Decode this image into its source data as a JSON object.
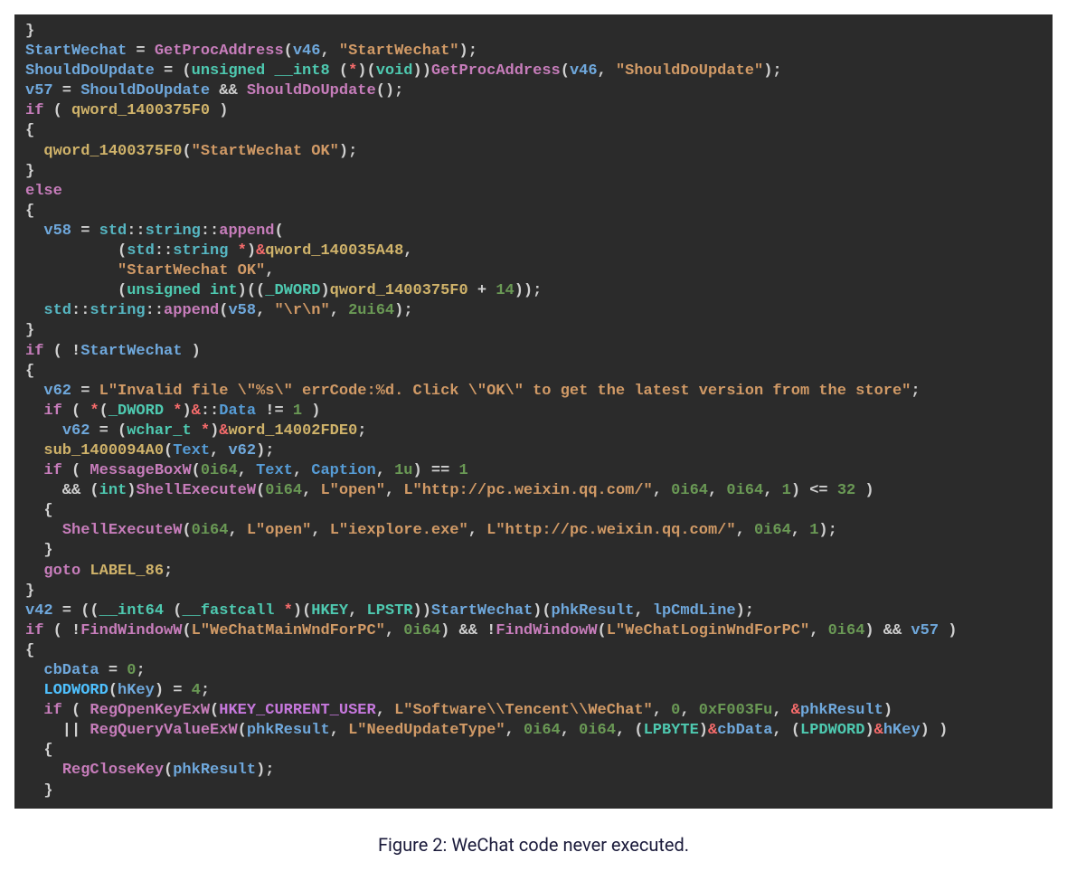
{
  "caption": "Figure 2: WeChat code never executed.",
  "code": {
    "lines": [
      [
        {
          "t": "t-sym",
          "v": "}"
        }
      ],
      [
        {
          "t": "t-var",
          "v": "StartWechat"
        },
        {
          "t": "t-sym",
          "v": " = "
        },
        {
          "t": "t-fn",
          "v": "GetProcAddress"
        },
        {
          "t": "t-sym",
          "v": "("
        },
        {
          "t": "t-var",
          "v": "v46"
        },
        {
          "t": "t-sym",
          "v": ", "
        },
        {
          "t": "t-str",
          "v": "\"StartWechat\""
        },
        {
          "t": "t-sym",
          "v": ");"
        }
      ],
      [
        {
          "t": "t-var",
          "v": "ShouldDoUpdate"
        },
        {
          "t": "t-sym",
          "v": " = ("
        },
        {
          "t": "t-type",
          "v": "unsigned __int8"
        },
        {
          "t": "t-sym",
          "v": " ("
        },
        {
          "t": "t-amp",
          "v": "*"
        },
        {
          "t": "t-sym",
          "v": ")("
        },
        {
          "t": "t-type",
          "v": "void"
        },
        {
          "t": "t-sym",
          "v": "))"
        },
        {
          "t": "t-fn",
          "v": "GetProcAddress"
        },
        {
          "t": "t-sym",
          "v": "("
        },
        {
          "t": "t-var",
          "v": "v46"
        },
        {
          "t": "t-sym",
          "v": ", "
        },
        {
          "t": "t-str",
          "v": "\"ShouldDoUpdate\""
        },
        {
          "t": "t-sym",
          "v": ");"
        }
      ],
      [
        {
          "t": "t-var",
          "v": "v57"
        },
        {
          "t": "t-sym",
          "v": " = "
        },
        {
          "t": "t-var",
          "v": "ShouldDoUpdate"
        },
        {
          "t": "t-sym",
          "v": " && "
        },
        {
          "t": "t-fn",
          "v": "ShouldDoUpdate"
        },
        {
          "t": "t-sym",
          "v": "();"
        }
      ],
      [
        {
          "t": "t-kw",
          "v": "if"
        },
        {
          "t": "t-sym",
          "v": " ( "
        },
        {
          "t": "t-glob",
          "v": "qword_1400375F0"
        },
        {
          "t": "t-sym",
          "v": " )"
        }
      ],
      [
        {
          "t": "t-sym",
          "v": "{"
        }
      ],
      [
        {
          "t": "t-sym",
          "v": "  "
        },
        {
          "t": "t-glob",
          "v": "qword_1400375F0"
        },
        {
          "t": "t-sym",
          "v": "("
        },
        {
          "t": "t-str",
          "v": "\"StartWechat OK\""
        },
        {
          "t": "t-sym",
          "v": ");"
        }
      ],
      [
        {
          "t": "t-sym",
          "v": "}"
        }
      ],
      [
        {
          "t": "t-kw",
          "v": "else"
        }
      ],
      [
        {
          "t": "t-sym",
          "v": "{"
        }
      ],
      [
        {
          "t": "t-sym",
          "v": "  "
        },
        {
          "t": "t-var",
          "v": "v58"
        },
        {
          "t": "t-sym",
          "v": " = "
        },
        {
          "t": "t-ns",
          "v": "std"
        },
        {
          "t": "t-sym",
          "v": "::"
        },
        {
          "t": "t-ns",
          "v": "string"
        },
        {
          "t": "t-sym",
          "v": "::"
        },
        {
          "t": "t-fn",
          "v": "append"
        },
        {
          "t": "t-sym",
          "v": "("
        }
      ],
      [
        {
          "t": "t-sym",
          "v": "          ("
        },
        {
          "t": "t-ns",
          "v": "std"
        },
        {
          "t": "t-sym",
          "v": "::"
        },
        {
          "t": "t-ns",
          "v": "string"
        },
        {
          "t": "t-sym",
          "v": " "
        },
        {
          "t": "t-amp",
          "v": "*"
        },
        {
          "t": "t-sym",
          "v": ")"
        },
        {
          "t": "t-amp",
          "v": "&"
        },
        {
          "t": "t-glob",
          "v": "qword_140035A48"
        },
        {
          "t": "t-sym",
          "v": ","
        }
      ],
      [
        {
          "t": "t-sym",
          "v": "          "
        },
        {
          "t": "t-str",
          "v": "\"StartWechat OK\""
        },
        {
          "t": "t-sym",
          "v": ","
        }
      ],
      [
        {
          "t": "t-sym",
          "v": "          ("
        },
        {
          "t": "t-type",
          "v": "unsigned int"
        },
        {
          "t": "t-sym",
          "v": ")(("
        },
        {
          "t": "t-type",
          "v": "_DWORD"
        },
        {
          "t": "t-sym",
          "v": ")"
        },
        {
          "t": "t-glob",
          "v": "qword_1400375F0"
        },
        {
          "t": "t-sym",
          "v": " + "
        },
        {
          "t": "t-num",
          "v": "14"
        },
        {
          "t": "t-sym",
          "v": "));"
        }
      ],
      [
        {
          "t": "t-sym",
          "v": "  "
        },
        {
          "t": "t-ns",
          "v": "std"
        },
        {
          "t": "t-sym",
          "v": "::"
        },
        {
          "t": "t-ns",
          "v": "string"
        },
        {
          "t": "t-sym",
          "v": "::"
        },
        {
          "t": "t-fn",
          "v": "append"
        },
        {
          "t": "t-sym",
          "v": "("
        },
        {
          "t": "t-var",
          "v": "v58"
        },
        {
          "t": "t-sym",
          "v": ", "
        },
        {
          "t": "t-str",
          "v": "\"\\r\\n\""
        },
        {
          "t": "t-sym",
          "v": ", "
        },
        {
          "t": "t-num",
          "v": "2ui64"
        },
        {
          "t": "t-sym",
          "v": ");"
        }
      ],
      [
        {
          "t": "t-sym",
          "v": "}"
        }
      ],
      [
        {
          "t": "t-kw",
          "v": "if"
        },
        {
          "t": "t-sym",
          "v": " ( !"
        },
        {
          "t": "t-var",
          "v": "StartWechat"
        },
        {
          "t": "t-sym",
          "v": " )"
        }
      ],
      [
        {
          "t": "t-sym",
          "v": "{"
        }
      ],
      [
        {
          "t": "t-sym",
          "v": "  "
        },
        {
          "t": "t-var",
          "v": "v62"
        },
        {
          "t": "t-sym",
          "v": " = "
        },
        {
          "t": "t-str",
          "v": "L\"Invalid file \\\"%s\\\" errCode:%d. Click \\\"OK\\\" to get the latest version from the store\""
        },
        {
          "t": "t-sym",
          "v": ";"
        }
      ],
      [
        {
          "t": "t-sym",
          "v": "  "
        },
        {
          "t": "t-kw",
          "v": "if"
        },
        {
          "t": "t-sym",
          "v": " ( "
        },
        {
          "t": "t-amp",
          "v": "*"
        },
        {
          "t": "t-sym",
          "v": "("
        },
        {
          "t": "t-type",
          "v": "_DWORD "
        },
        {
          "t": "t-amp",
          "v": "*"
        },
        {
          "t": "t-sym",
          "v": ")"
        },
        {
          "t": "t-amp",
          "v": "&"
        },
        {
          "t": "t-sym",
          "v": "::"
        },
        {
          "t": "t-text",
          "v": "Data"
        },
        {
          "t": "t-sym",
          "v": " != "
        },
        {
          "t": "t-num",
          "v": "1"
        },
        {
          "t": "t-sym",
          "v": " )"
        }
      ],
      [
        {
          "t": "t-sym",
          "v": "    "
        },
        {
          "t": "t-var",
          "v": "v62"
        },
        {
          "t": "t-sym",
          "v": " = ("
        },
        {
          "t": "t-type",
          "v": "wchar_t "
        },
        {
          "t": "t-amp",
          "v": "*"
        },
        {
          "t": "t-sym",
          "v": ")"
        },
        {
          "t": "t-amp",
          "v": "&"
        },
        {
          "t": "t-glob",
          "v": "word_14002FDE0"
        },
        {
          "t": "t-sym",
          "v": ";"
        }
      ],
      [
        {
          "t": "t-sym",
          "v": "  "
        },
        {
          "t": "t-glob",
          "v": "sub_1400094A0"
        },
        {
          "t": "t-sym",
          "v": "("
        },
        {
          "t": "t-text",
          "v": "Text"
        },
        {
          "t": "t-sym",
          "v": ", "
        },
        {
          "t": "t-var",
          "v": "v62"
        },
        {
          "t": "t-sym",
          "v": ");"
        }
      ],
      [
        {
          "t": "t-sym",
          "v": "  "
        },
        {
          "t": "t-kw",
          "v": "if"
        },
        {
          "t": "t-sym",
          "v": " ( "
        },
        {
          "t": "t-fn",
          "v": "MessageBoxW"
        },
        {
          "t": "t-sym",
          "v": "("
        },
        {
          "t": "t-num",
          "v": "0i64"
        },
        {
          "t": "t-sym",
          "v": ", "
        },
        {
          "t": "t-text",
          "v": "Text"
        },
        {
          "t": "t-sym",
          "v": ", "
        },
        {
          "t": "t-text",
          "v": "Caption"
        },
        {
          "t": "t-sym",
          "v": ", "
        },
        {
          "t": "t-num",
          "v": "1u"
        },
        {
          "t": "t-sym",
          "v": ") == "
        },
        {
          "t": "t-num",
          "v": "1"
        }
      ],
      [
        {
          "t": "t-sym",
          "v": "    && ("
        },
        {
          "t": "t-type",
          "v": "int"
        },
        {
          "t": "t-sym",
          "v": ")"
        },
        {
          "t": "t-fn",
          "v": "ShellExecuteW"
        },
        {
          "t": "t-sym",
          "v": "("
        },
        {
          "t": "t-num",
          "v": "0i64"
        },
        {
          "t": "t-sym",
          "v": ", "
        },
        {
          "t": "t-str",
          "v": "L\"open\""
        },
        {
          "t": "t-sym",
          "v": ", "
        },
        {
          "t": "t-str",
          "v": "L\"http://pc.weixin.qq.com/\""
        },
        {
          "t": "t-sym",
          "v": ", "
        },
        {
          "t": "t-num",
          "v": "0i64"
        },
        {
          "t": "t-sym",
          "v": ", "
        },
        {
          "t": "t-num",
          "v": "0i64"
        },
        {
          "t": "t-sym",
          "v": ", "
        },
        {
          "t": "t-num",
          "v": "1"
        },
        {
          "t": "t-sym",
          "v": ") <= "
        },
        {
          "t": "t-num",
          "v": "32"
        },
        {
          "t": "t-sym",
          "v": " )"
        }
      ],
      [
        {
          "t": "t-sym",
          "v": "  {"
        }
      ],
      [
        {
          "t": "t-sym",
          "v": "    "
        },
        {
          "t": "t-fn",
          "v": "ShellExecuteW"
        },
        {
          "t": "t-sym",
          "v": "("
        },
        {
          "t": "t-num",
          "v": "0i64"
        },
        {
          "t": "t-sym",
          "v": ", "
        },
        {
          "t": "t-str",
          "v": "L\"open\""
        },
        {
          "t": "t-sym",
          "v": ", "
        },
        {
          "t": "t-str",
          "v": "L\"iexplore.exe\""
        },
        {
          "t": "t-sym",
          "v": ", "
        },
        {
          "t": "t-str",
          "v": "L\"http://pc.weixin.qq.com/\""
        },
        {
          "t": "t-sym",
          "v": ", "
        },
        {
          "t": "t-num",
          "v": "0i64"
        },
        {
          "t": "t-sym",
          "v": ", "
        },
        {
          "t": "t-num",
          "v": "1"
        },
        {
          "t": "t-sym",
          "v": ");"
        }
      ],
      [
        {
          "t": "t-sym",
          "v": "  }"
        }
      ],
      [
        {
          "t": "t-sym",
          "v": "  "
        },
        {
          "t": "t-kw",
          "v": "goto"
        },
        {
          "t": "t-sym",
          "v": " "
        },
        {
          "t": "t-glob",
          "v": "LABEL_86"
        },
        {
          "t": "t-sym",
          "v": ";"
        }
      ],
      [
        {
          "t": "t-sym",
          "v": "}"
        }
      ],
      [
        {
          "t": "t-var",
          "v": "v42"
        },
        {
          "t": "t-sym",
          "v": " = (("
        },
        {
          "t": "t-type",
          "v": "__int64"
        },
        {
          "t": "t-sym",
          "v": " ("
        },
        {
          "t": "t-type",
          "v": "__fastcall "
        },
        {
          "t": "t-amp",
          "v": "*"
        },
        {
          "t": "t-sym",
          "v": ")("
        },
        {
          "t": "t-type",
          "v": "HKEY"
        },
        {
          "t": "t-sym",
          "v": ", "
        },
        {
          "t": "t-type",
          "v": "LPSTR"
        },
        {
          "t": "t-sym",
          "v": "))"
        },
        {
          "t": "t-var",
          "v": "StartWechat"
        },
        {
          "t": "t-sym",
          "v": ")("
        },
        {
          "t": "t-var",
          "v": "phkResult"
        },
        {
          "t": "t-sym",
          "v": ", "
        },
        {
          "t": "t-var",
          "v": "lpCmdLine"
        },
        {
          "t": "t-sym",
          "v": ");"
        }
      ],
      [
        {
          "t": "t-kw",
          "v": "if"
        },
        {
          "t": "t-sym",
          "v": " ( !"
        },
        {
          "t": "t-fn",
          "v": "FindWindowW"
        },
        {
          "t": "t-sym",
          "v": "("
        },
        {
          "t": "t-str",
          "v": "L\"WeChatMainWndForPC\""
        },
        {
          "t": "t-sym",
          "v": ", "
        },
        {
          "t": "t-num",
          "v": "0i64"
        },
        {
          "t": "t-sym",
          "v": ") && !"
        },
        {
          "t": "t-fn",
          "v": "FindWindowW"
        },
        {
          "t": "t-sym",
          "v": "("
        },
        {
          "t": "t-str",
          "v": "L\"WeChatLoginWndForPC\""
        },
        {
          "t": "t-sym",
          "v": ", "
        },
        {
          "t": "t-num",
          "v": "0i64"
        },
        {
          "t": "t-sym",
          "v": ") && "
        },
        {
          "t": "t-var",
          "v": "v57"
        },
        {
          "t": "t-sym",
          "v": " )"
        }
      ],
      [
        {
          "t": "t-sym",
          "v": "{"
        }
      ],
      [
        {
          "t": "t-sym",
          "v": "  "
        },
        {
          "t": "t-var",
          "v": "cbData"
        },
        {
          "t": "t-sym",
          "v": " = "
        },
        {
          "t": "t-num",
          "v": "0"
        },
        {
          "t": "t-sym",
          "v": ";"
        }
      ],
      [
        {
          "t": "t-sym",
          "v": "  "
        },
        {
          "t": "t-mac",
          "v": "LODWORD"
        },
        {
          "t": "t-sym",
          "v": "("
        },
        {
          "t": "t-var",
          "v": "hKey"
        },
        {
          "t": "t-sym",
          "v": ") = "
        },
        {
          "t": "t-num",
          "v": "4"
        },
        {
          "t": "t-sym",
          "v": ";"
        }
      ],
      [
        {
          "t": "t-sym",
          "v": "  "
        },
        {
          "t": "t-kw",
          "v": "if"
        },
        {
          "t": "t-sym",
          "v": " ( "
        },
        {
          "t": "t-fn",
          "v": "RegOpenKeyExW"
        },
        {
          "t": "t-sym",
          "v": "("
        },
        {
          "t": "t-cnst",
          "v": "HKEY_CURRENT_USER"
        },
        {
          "t": "t-sym",
          "v": ", "
        },
        {
          "t": "t-str",
          "v": "L\"Software\\\\Tencent\\\\WeChat\""
        },
        {
          "t": "t-sym",
          "v": ", "
        },
        {
          "t": "t-num",
          "v": "0"
        },
        {
          "t": "t-sym",
          "v": ", "
        },
        {
          "t": "t-num",
          "v": "0xF003Fu"
        },
        {
          "t": "t-sym",
          "v": ", "
        },
        {
          "t": "t-amp",
          "v": "&"
        },
        {
          "t": "t-var",
          "v": "phkResult"
        },
        {
          "t": "t-sym",
          "v": ")"
        }
      ],
      [
        {
          "t": "t-sym",
          "v": "    || "
        },
        {
          "t": "t-fn",
          "v": "RegQueryValueExW"
        },
        {
          "t": "t-sym",
          "v": "("
        },
        {
          "t": "t-var",
          "v": "phkResult"
        },
        {
          "t": "t-sym",
          "v": ", "
        },
        {
          "t": "t-str",
          "v": "L\"NeedUpdateType\""
        },
        {
          "t": "t-sym",
          "v": ", "
        },
        {
          "t": "t-num",
          "v": "0i64"
        },
        {
          "t": "t-sym",
          "v": ", "
        },
        {
          "t": "t-num",
          "v": "0i64"
        },
        {
          "t": "t-sym",
          "v": ", ("
        },
        {
          "t": "t-type",
          "v": "LPBYTE"
        },
        {
          "t": "t-sym",
          "v": ")"
        },
        {
          "t": "t-amp",
          "v": "&"
        },
        {
          "t": "t-var",
          "v": "cbData"
        },
        {
          "t": "t-sym",
          "v": ", ("
        },
        {
          "t": "t-type",
          "v": "LPDWORD"
        },
        {
          "t": "t-sym",
          "v": ")"
        },
        {
          "t": "t-amp",
          "v": "&"
        },
        {
          "t": "t-var",
          "v": "hKey"
        },
        {
          "t": "t-sym",
          "v": ") )"
        }
      ],
      [
        {
          "t": "t-sym",
          "v": "  {"
        }
      ],
      [
        {
          "t": "t-sym",
          "v": "    "
        },
        {
          "t": "t-fn",
          "v": "RegCloseKey"
        },
        {
          "t": "t-sym",
          "v": "("
        },
        {
          "t": "t-var",
          "v": "phkResult"
        },
        {
          "t": "t-sym",
          "v": ");"
        }
      ],
      [
        {
          "t": "t-sym",
          "v": "  }"
        }
      ]
    ]
  }
}
